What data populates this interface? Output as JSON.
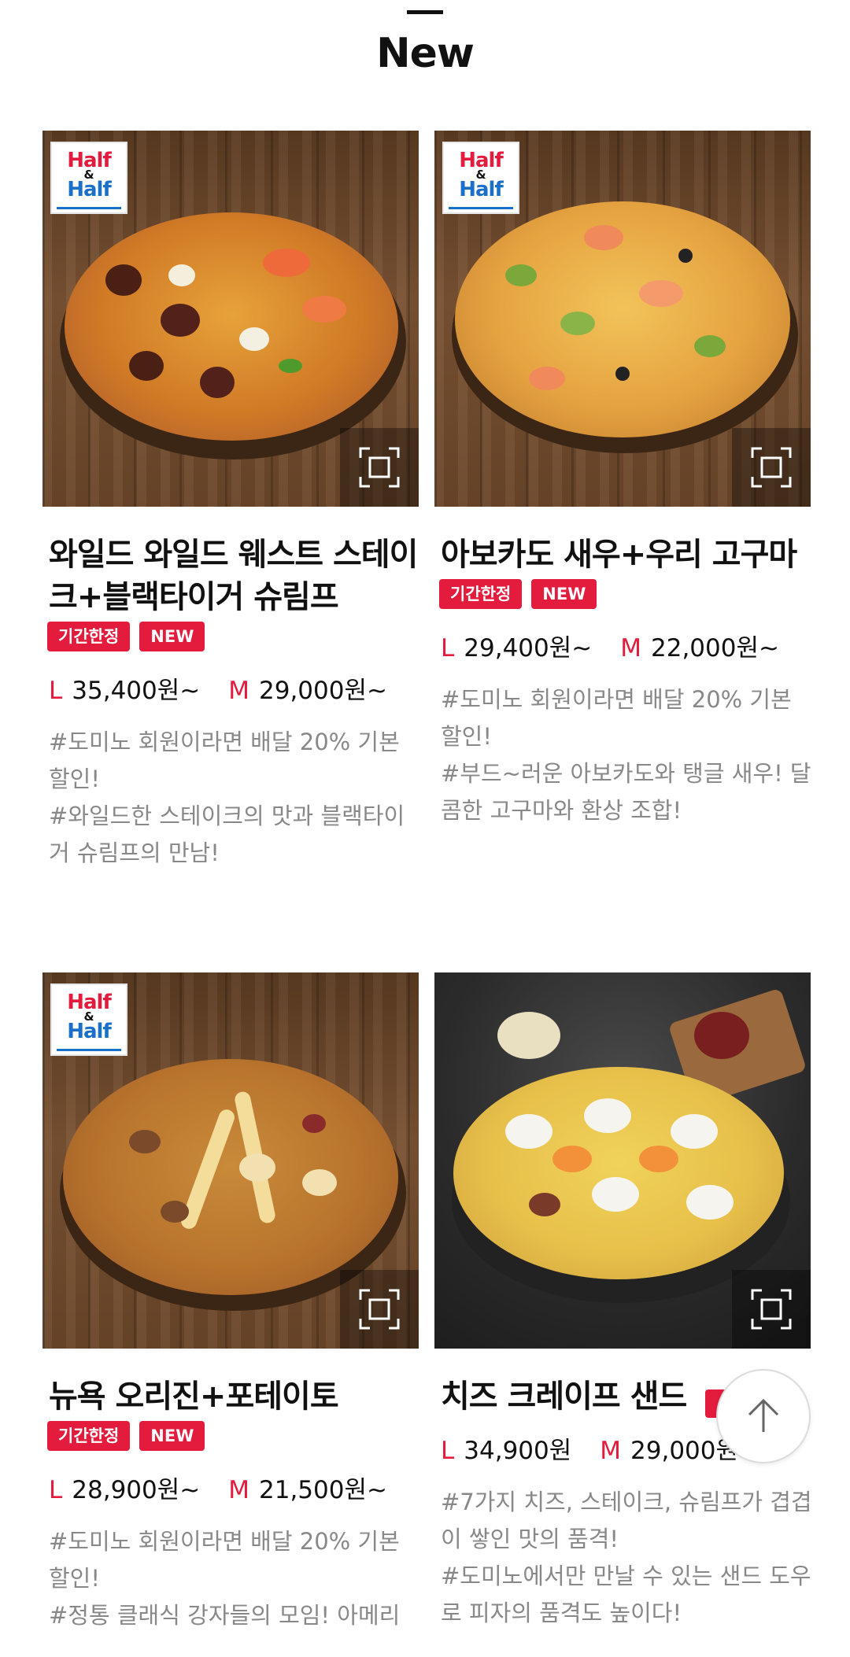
{
  "section": {
    "title": "New"
  },
  "half_logo": {
    "line1": "Half",
    "amp": "&",
    "line2": "Half"
  },
  "badges": {
    "limited": "기간한정",
    "new": "NEW"
  },
  "size_labels": {
    "large": "L",
    "medium": "M"
  },
  "products": [
    {
      "name": "와일드 와일드 웨스트 스테이크+블랙타이거 슈림프",
      "large_price": "35,400원~",
      "medium_price": "29,000원~",
      "desc": "#도미노 회원이라면 배달 20% 기본 할인!\n#와일드한 스테이크의 맛과 블랙타이거 슈림프의 만남!"
    },
    {
      "name": "아보카도 새우+우리 고구마",
      "large_price": "29,400원~",
      "medium_price": "22,000원~",
      "desc": "#도미노 회원이라면 배달 20% 기본 할인!\n#부드~러운 아보카도와 탱글 새우! 달콤한 고구마와 환상 조합!"
    },
    {
      "name": "뉴욕 오리진+포테이토",
      "large_price": "28,900원~",
      "medium_price": "21,500원~",
      "desc": "#도미노 회원이라면 배달 20% 기본 할인!\n#정통 클래식 강자들의 모임! 아메리"
    },
    {
      "name": "치즈 크레이프 샌드",
      "large_price": "34,900원",
      "medium_price": "29,000원",
      "desc": "#7가지 치즈, 스테이크, 슈림프가 겹겹이 쌓인 맛의 품격!\n#도미노에서만 만날 수 있는 샌드 도우로 피자의 품격도 높이다!"
    }
  ],
  "colors": {
    "accent": "#e31b3c",
    "text": "#111111",
    "muted": "#888888"
  },
  "icons": {
    "zoom": "expand-frame-icon",
    "top": "arrow-up-icon"
  }
}
